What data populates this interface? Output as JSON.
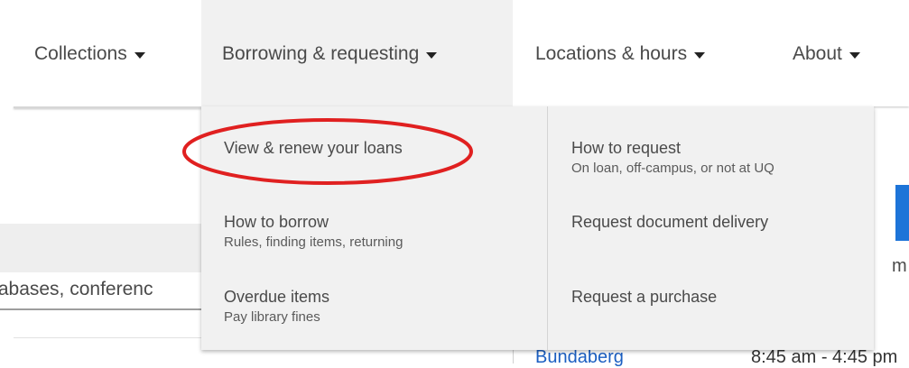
{
  "nav": {
    "items": [
      {
        "label": "Collections"
      },
      {
        "label": "Borrowing & requesting"
      },
      {
        "label": "Locations & hours"
      },
      {
        "label": "About"
      }
    ]
  },
  "dropdown": {
    "left_column": [
      {
        "title": "View & renew your loans",
        "subtitle": ""
      },
      {
        "title": "How to borrow",
        "subtitle": "Rules, finding items, returning"
      },
      {
        "title": "Overdue items",
        "subtitle": "Pay library fines"
      }
    ],
    "right_column": [
      {
        "title": "How to request",
        "subtitle": "On loan, off-campus, or not at UQ"
      },
      {
        "title": "Request document delivery",
        "subtitle": ""
      },
      {
        "title": "Request a purchase",
        "subtitle": ""
      }
    ]
  },
  "background": {
    "search_text": "tabases, conferenc",
    "partial_letter": "m",
    "location_link": "Bundaberg",
    "location_hours": "8:45 am - 4:45 pm"
  },
  "annotation": {
    "ellipse_color": "#e02020"
  }
}
